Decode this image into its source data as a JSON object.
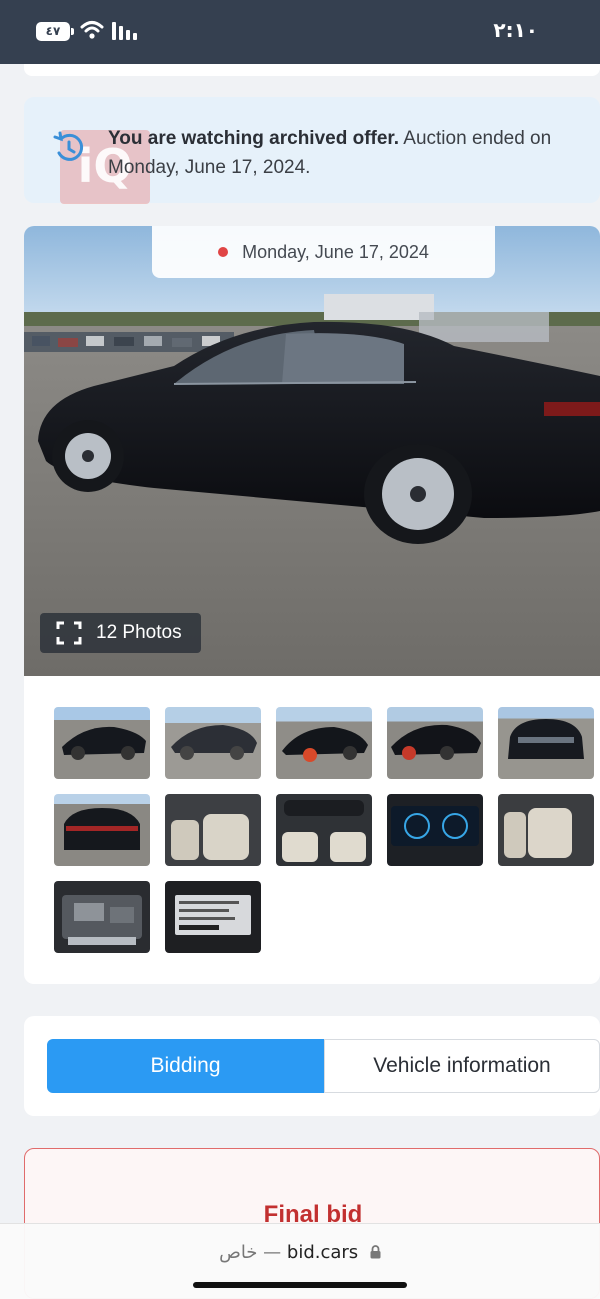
{
  "status_bar": {
    "time": "٢:١٠",
    "battery": "٤٧"
  },
  "archived_notice": {
    "bold_text": "You are watching archived offer.",
    "text": " Auction ended on Monday, June 17, 2024.",
    "watermark": "iQ"
  },
  "gallery": {
    "date": "Monday, June 17, 2024",
    "photos_button": "12 Photos",
    "thumbnail_count": 12
  },
  "tabs": {
    "bidding": "Bidding",
    "vehicle_information": "Vehicle information",
    "active": "Bidding"
  },
  "bid": {
    "title": "Final bid"
  },
  "browser": {
    "private_label": "خاص —",
    "domain": "bid.cars"
  },
  "colors": {
    "status_bar": "#354050",
    "accent": "#2b9af3",
    "final_bid": "#c23030",
    "notice_bg": "#e6f1fa"
  }
}
